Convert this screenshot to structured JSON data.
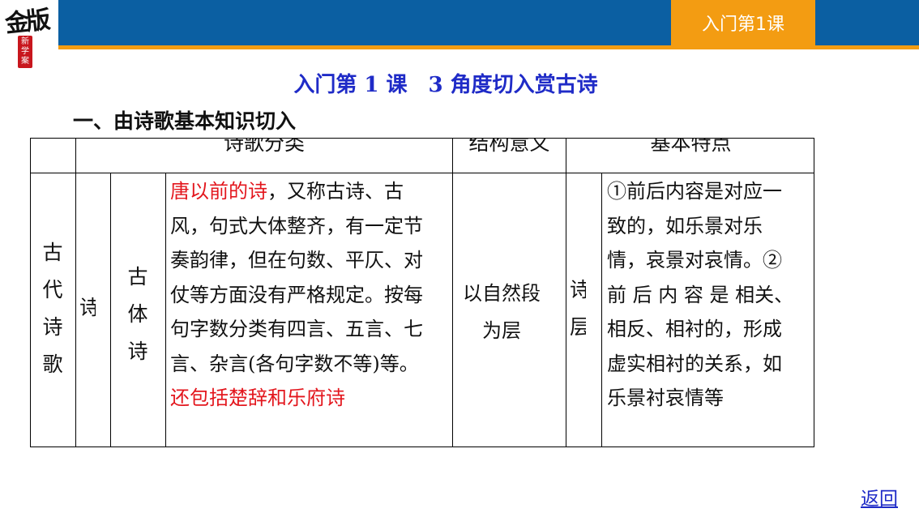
{
  "header": {
    "logo_text": "金版",
    "logo_seal": "新学案",
    "lesson_tab": "入门第1课"
  },
  "page_title": "入门第 1 课　3 角度切入赏古诗",
  "section_heading": "一、由诗歌基本知识切入",
  "table": {
    "headers": {
      "category": "诗歌分类",
      "structure": "结构意义",
      "features": "基本特点"
    },
    "row1": {
      "col_a": "古代诗歌",
      "col_b": "诗",
      "col_c": "古体诗",
      "content_red1": "唐以前的诗",
      "content_main": "，又称古诗、古风，句式大体整齐，有一定节奏韵律，但在句数、平仄、对仗等方面没有严格规定。按每句字数分类有四言、五言、七言、杂言(各句字数不等)等。",
      "content_red2": "还包括楚辞和乐府诗",
      "structure": "以自然段为层",
      "col_f": "诗层",
      "features": "①前后内容是对应一致的，如乐景对乐情，哀景对哀情。② 前 后 内 容 是 相关、相反、相衬的，形成虚实相衬的关系，如乐景衬哀情等"
    }
  },
  "footer": {
    "return_label": "返回"
  }
}
